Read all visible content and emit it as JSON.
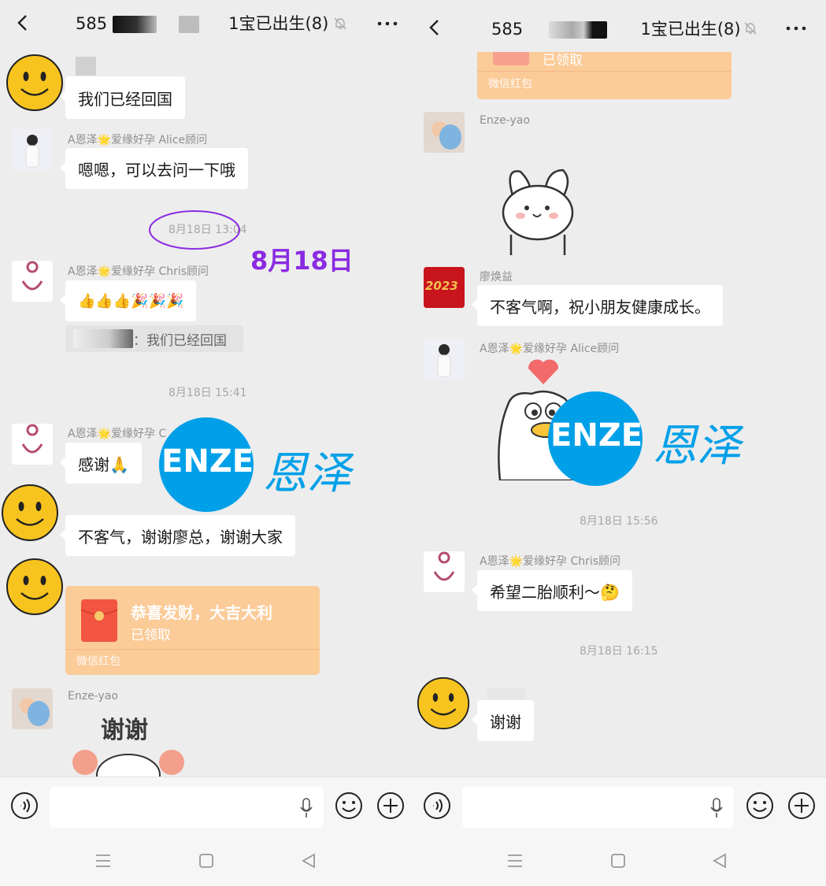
{
  "left": {
    "title": {
      "prefix": "585",
      "suffix": "1宝已出生(8)"
    },
    "messages": {
      "m1": "我们已经回国",
      "m2_sender": "A恩泽🌟爱缘好孕 Alice顾问",
      "m2": "嗯嗯，可以去问一下哦",
      "t1": "8月18日 13:04",
      "annotation": "8月18日",
      "m3_sender": "A恩泽🌟爱缘好孕 Chris顾问",
      "m3": "👍👍👍🎉🎉🎉",
      "m3_quote": "：我们已经回国",
      "t2": "8月18日 15:41",
      "m4_sender": "A恩泽🌟爱缘好孕 C",
      "m4": "感谢🙏",
      "m5": "不客气，谢谢廖总，谢谢大家",
      "rp_title": "恭喜发财，大吉大利",
      "rp_status": "已领取",
      "rp_footer": "微信红包",
      "m6_sender": "Enze-yao",
      "m6_sticker_text": "谢谢"
    }
  },
  "right": {
    "title": {
      "prefix": "585",
      "suffix": "1宝已出生(8)"
    },
    "messages": {
      "rp_status": "已领取",
      "rp_footer": "微信红包",
      "s1_sender": "Enze-yao",
      "m1_sender": "廖焕益",
      "m1": "不客气啊，祝小朋友健康成长。",
      "avatar_badge": "2023",
      "s2_sender": "A恩泽🌟爱缘好孕 Alice顾问",
      "t1": "8月18日 15:56",
      "m2_sender": "A恩泽🌟爱缘好孕 Chris顾问",
      "m2": "希望二胎顺利～🤔",
      "t2": "8月18日 16:15",
      "m3": "谢谢"
    }
  },
  "watermark": {
    "latin": "ENZE",
    "cn": "恩泽"
  },
  "colors": {
    "accent_annotation": "#8a2be2",
    "watermark_blue": "#00a0e9",
    "redpacket": "#fbcb98"
  }
}
